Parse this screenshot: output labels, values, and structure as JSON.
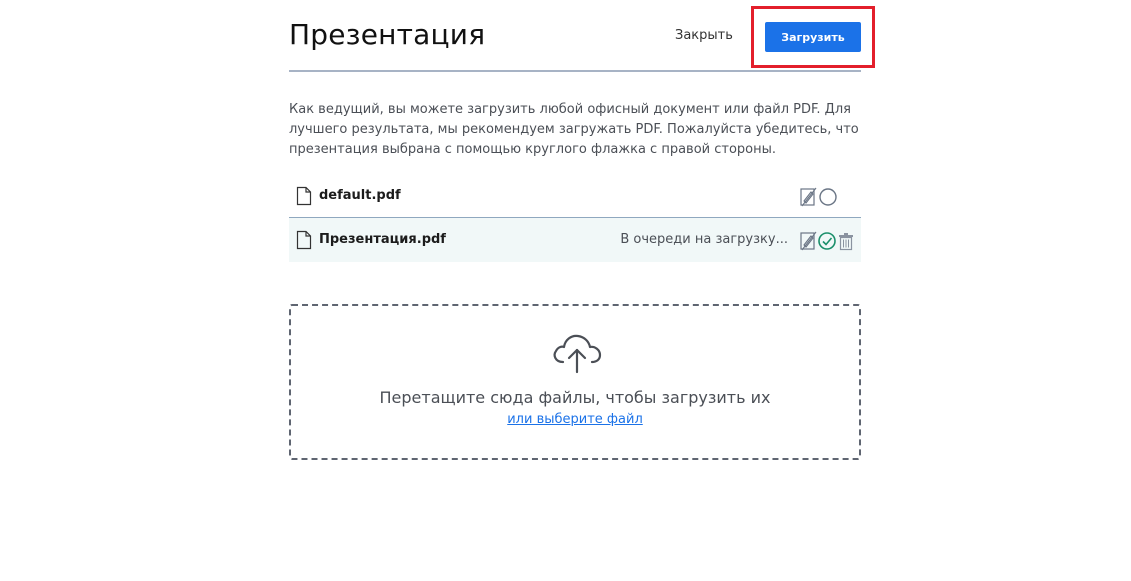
{
  "header": {
    "title": "Презентация",
    "close_label": "Закрыть",
    "upload_label": "Загрузить"
  },
  "description": "Как ведущий, вы можете загрузить любой офисный документ или файл PDF. Для лучшего результата, мы рекомендуем загружать PDF. Пожалуйста убедитесь, что презентация выбрана с помощью круглого флажка с правой стороны.",
  "files": [
    {
      "name": "default.pdf",
      "status": "",
      "icons": [
        "document-icon",
        "annotation-toggle-icon",
        "select-circle-icon"
      ],
      "selected": false
    },
    {
      "name": "Презентация.pdf",
      "status": "В очереди на загрузку...",
      "icons": [
        "document-icon",
        "annotation-toggle-icon",
        "selected-check-icon",
        "trash-icon"
      ],
      "selected": true
    }
  ],
  "dropzone": {
    "text": "Перетащите сюда файлы, чтобы загрузить их",
    "link": "или выберите файл",
    "icon": "cloud-upload-icon"
  },
  "colors": {
    "accent": "#1b72e8",
    "highlight_border": "#e31f2b",
    "selected_check": "#1a8f6a",
    "row_selected_bg": "#f1f8f8"
  }
}
